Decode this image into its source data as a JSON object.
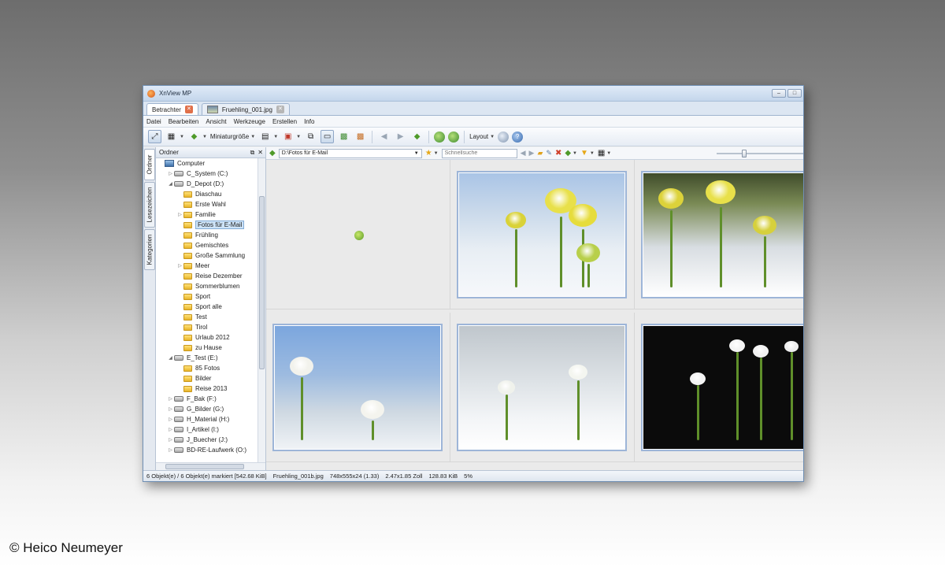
{
  "app": {
    "title": "XnView MP"
  },
  "tabs": [
    {
      "label": "Betrachter",
      "active": true
    },
    {
      "label": "Fruehling_001.jpg",
      "active": false
    }
  ],
  "menu": [
    "Datei",
    "Bearbeiten",
    "Ansicht",
    "Werkzeuge",
    "Erstellen",
    "Info"
  ],
  "toolbar": {
    "thumbnail_size_label": "Miniaturgröße",
    "layout_label": "Layout"
  },
  "side_tabs": [
    "Ordner",
    "Lesezeichen",
    "Kategorien"
  ],
  "folder_pane": {
    "title": "Ordner"
  },
  "tree": [
    {
      "label": "Computer",
      "type": "pc",
      "level": 0,
      "arrow": ""
    },
    {
      "label": "C_System (C:)",
      "type": "drive",
      "level": 1,
      "arrow": "▷"
    },
    {
      "label": "D_Depot (D:)",
      "type": "drive",
      "level": 1,
      "arrow": "◢"
    },
    {
      "label": "Diaschau",
      "type": "folder",
      "level": 2,
      "arrow": ""
    },
    {
      "label": "Erste Wahl",
      "type": "folder",
      "level": 2,
      "arrow": ""
    },
    {
      "label": "Familie",
      "type": "folder",
      "level": 2,
      "arrow": "▷"
    },
    {
      "label": "Fotos für E-Mail",
      "type": "folder",
      "level": 2,
      "arrow": "",
      "selected": true
    },
    {
      "label": "Frühling",
      "type": "folder",
      "level": 2,
      "arrow": ""
    },
    {
      "label": "Gemischtes",
      "type": "folder",
      "level": 2,
      "arrow": ""
    },
    {
      "label": "Große Sammlung",
      "type": "folder",
      "level": 2,
      "arrow": ""
    },
    {
      "label": "Meer",
      "type": "folder",
      "level": 2,
      "arrow": "▷"
    },
    {
      "label": "Reise Dezember",
      "type": "folder",
      "level": 2,
      "arrow": ""
    },
    {
      "label": "Sommerblumen",
      "type": "folder",
      "level": 2,
      "arrow": ""
    },
    {
      "label": "Sport",
      "type": "folder",
      "level": 2,
      "arrow": ""
    },
    {
      "label": "Sport alle",
      "type": "folder",
      "level": 2,
      "arrow": ""
    },
    {
      "label": "Test",
      "type": "folder",
      "level": 2,
      "arrow": ""
    },
    {
      "label": "Tirol",
      "type": "folder",
      "level": 2,
      "arrow": ""
    },
    {
      "label": "Urlaub 2012",
      "type": "folder",
      "level": 2,
      "arrow": ""
    },
    {
      "label": "zu Hause",
      "type": "folder",
      "level": 2,
      "arrow": ""
    },
    {
      "label": "E_Test (E:)",
      "type": "drive",
      "level": 1,
      "arrow": "◢"
    },
    {
      "label": "85 Fotos",
      "type": "folder",
      "level": 2,
      "arrow": ""
    },
    {
      "label": "Bilder",
      "type": "folder",
      "level": 2,
      "arrow": ""
    },
    {
      "label": "Reise 2013",
      "type": "folder",
      "level": 2,
      "arrow": ""
    },
    {
      "label": "F_Bak (F:)",
      "type": "drive",
      "level": 1,
      "arrow": "▷"
    },
    {
      "label": "G_Bilder (G:)",
      "type": "drive",
      "level": 1,
      "arrow": "▷"
    },
    {
      "label": "H_Material (H:)",
      "type": "drive",
      "level": 1,
      "arrow": "▷"
    },
    {
      "label": "I_Artikel (I:)",
      "type": "drive",
      "level": 1,
      "arrow": "▷"
    },
    {
      "label": "J_Buecher (J:)",
      "type": "drive",
      "level": 1,
      "arrow": "▷"
    },
    {
      "label": "BD-RE-Laufwerk (O:)",
      "type": "drive",
      "level": 1,
      "arrow": "▷"
    }
  ],
  "address": {
    "path": "D:\\Fotos für E-Mail",
    "search_placeholder": "Schnellsuche"
  },
  "thumbnails": [
    {
      "kind": "loading"
    },
    {
      "kind": "photo",
      "style": "ph1",
      "subject": "yellow primroses in snow"
    },
    {
      "kind": "photo",
      "style": "ph2",
      "subject": "yellow primroses in snow"
    },
    {
      "kind": "photo",
      "style": "ph3",
      "subject": "snowflakes against blue sky"
    },
    {
      "kind": "photo",
      "style": "ph4",
      "subject": "snowdrops sprouting from snow"
    },
    {
      "kind": "photo",
      "style": "ph5",
      "subject": "snowdrops on black background"
    }
  ],
  "status": {
    "count": "6 Objekt(e) / 6 Objekt(e) markiert [542.68 KiB]",
    "filename": "Fruehling_001b.jpg",
    "dimensions": "748x555x24 (1.33)",
    "print_size": "2.47x1.85 Zoll",
    "file_size": "128.83 KiB",
    "zoom": "5%"
  },
  "credit": "© Heico Neumeyer"
}
